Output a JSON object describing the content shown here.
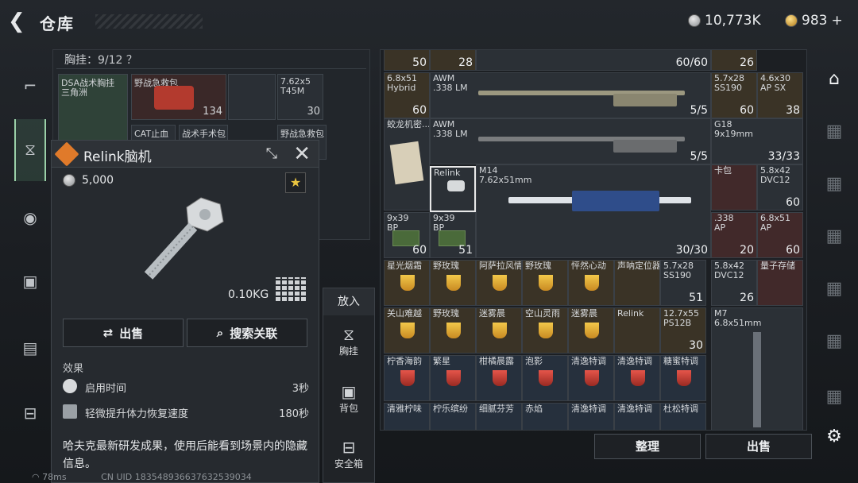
{
  "header": {
    "title": "仓库",
    "currency_silver": "10,773K",
    "currency_gold": "983",
    "plus": "+"
  },
  "chest": {
    "header": "胸挂：9/12 ？",
    "slots": [
      {
        "label": "DSA战术胸挂",
        "label2": "三角洲"
      },
      {
        "label": "野战急救包",
        "count": "134"
      },
      {
        "label": ""
      },
      {
        "label": "7.62x5",
        "label2": "T45M",
        "count": "30"
      },
      {
        "label": "CAT止血"
      },
      {
        "label": "战术手术包"
      },
      {
        "label": "野战急救包"
      }
    ]
  },
  "popup": {
    "title": "Relink脑机",
    "price": "5,000",
    "weight": "0.10KG",
    "sell": "出售",
    "search": "搜索关联",
    "effects_title": "效果",
    "effects": [
      {
        "label": "启用时间",
        "value": "3秒"
      },
      {
        "label": "轻微提升体力恢复速度",
        "value": "180秒"
      }
    ],
    "description": "哈夫克最新研发成果，使用后能看到场景内的隐藏信息。"
  },
  "putin": {
    "header": "放入",
    "items": [
      {
        "label": "胸挂"
      },
      {
        "label": "背包"
      },
      {
        "label": "安全箱"
      }
    ]
  },
  "inventory": {
    "cells": [
      {
        "n": "",
        "c": "50"
      },
      {
        "n": "",
        "c": "28"
      },
      {
        "n": "",
        "c": "60/60"
      },
      {
        "n": "",
        "c": "26"
      },
      {
        "n": "6.8x51",
        "n2": "Hybrid",
        "c": "60"
      },
      {
        "n": "AWM",
        "n2": ".338 LM",
        "c": "5/5"
      },
      {
        "n": "5.7x28",
        "n2": "SS190",
        "c": "60"
      },
      {
        "n": "4.6x30",
        "n2": "AP SX",
        "c": "38"
      },
      {
        "n": "蛟龙机密...",
        "c": ""
      },
      {
        "n": "AWM",
        "n2": ".338 LM",
        "c": "5/5"
      },
      {
        "n": "G18",
        "n2": "9x19mm",
        "c": "33/33"
      },
      {
        "n": "Relink",
        "c": ""
      },
      {
        "n": "M14",
        "n2": "7.62x51mm",
        "c": "30/30"
      },
      {
        "n": "卡包",
        "c": ""
      },
      {
        "n": "5.8x42",
        "n2": "DVC12",
        "c": "60"
      },
      {
        "n": "9x39",
        "n2": "BP",
        "c": "60"
      },
      {
        "n": "9x39",
        "n2": "BP",
        "c": "51"
      },
      {
        "n": ".338",
        "n2": "AP",
        "c": "20"
      },
      {
        "n": "6.8x51",
        "n2": "AP",
        "c": "60"
      },
      {
        "n": "星光烟霜",
        "c": ""
      },
      {
        "n": "野玫瑰",
        "c": ""
      },
      {
        "n": "阿萨拉风情",
        "c": ""
      },
      {
        "n": "野玫瑰",
        "c": ""
      },
      {
        "n": "怦然心动",
        "c": ""
      },
      {
        "n": "声呐定位器",
        "c": ""
      },
      {
        "n": "5.7x28",
        "n2": "SS190",
        "c": "51"
      },
      {
        "n": "5.8x42",
        "n2": "DVC12",
        "c": "26"
      },
      {
        "n": "量子存储",
        "c": ""
      },
      {
        "n": "关山难越",
        "c": ""
      },
      {
        "n": "野玫瑰",
        "c": ""
      },
      {
        "n": "迷雾晨",
        "c": ""
      },
      {
        "n": "空山灵雨",
        "c": ""
      },
      {
        "n": "迷雾晨",
        "c": ""
      },
      {
        "n": "Relink",
        "c": ""
      },
      {
        "n": "12.7x55",
        "n2": "PS12B",
        "c": "30"
      },
      {
        "n": "M7",
        "n2": "6.8x51mm",
        "c": ""
      },
      {
        "n": "柠香海韵",
        "c": ""
      },
      {
        "n": "繁星",
        "c": ""
      },
      {
        "n": "柑橘晨露",
        "c": ""
      },
      {
        "n": "泡影",
        "c": ""
      },
      {
        "n": "清逸特调",
        "c": ""
      },
      {
        "n": "清逸特调",
        "c": ""
      },
      {
        "n": "糖蜜特调",
        "c": ""
      },
      {
        "n": "清雅柠味",
        "c": ""
      },
      {
        "n": "柠乐缤纷",
        "c": ""
      },
      {
        "n": "细腻芬芳",
        "c": ""
      },
      {
        "n": "赤焰",
        "c": ""
      },
      {
        "n": "清逸特调",
        "c": ""
      },
      {
        "n": "清逸特调",
        "c": ""
      },
      {
        "n": "杜松特调",
        "c": ""
      }
    ],
    "sort": "整理",
    "sell": "出售"
  },
  "status": {
    "ping": "78ms",
    "uid": "CN UID 183548936637632539034"
  }
}
